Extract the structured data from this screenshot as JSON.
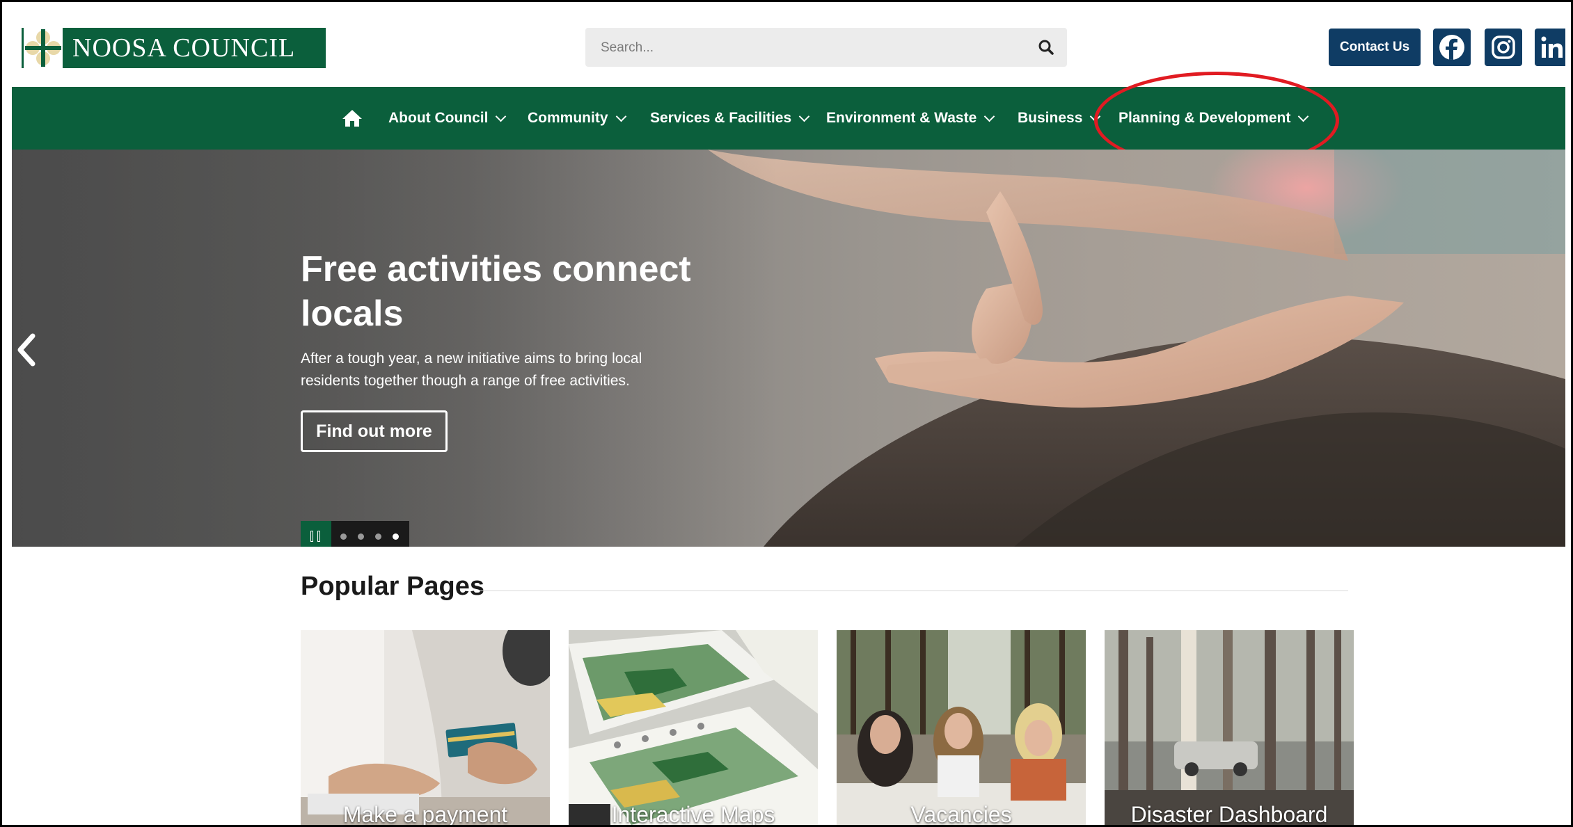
{
  "header": {
    "logo_text": "NOOSA COUNCIL",
    "search_placeholder": "Search...",
    "contact_label": "Contact Us",
    "social": [
      "facebook-icon",
      "instagram-icon",
      "linkedin-icon"
    ],
    "brand_color": "#0b5f3c",
    "contact_color": "#0f3c64"
  },
  "nav": {
    "items": [
      {
        "label": "About Council"
      },
      {
        "label": "Community"
      },
      {
        "label": "Services & Facilities"
      },
      {
        "label": "Environment & Waste"
      },
      {
        "label": "Business"
      },
      {
        "label": "Planning & Development"
      }
    ],
    "highlight_color": "#e11b22"
  },
  "hero": {
    "title": "Free activities connect locals",
    "text": "After a tough year, a new initiative aims to bring local residents together though a range of free activities.",
    "button_label": "Find out more",
    "slides_count": 4,
    "active_slide": 4
  },
  "popular": {
    "title": "Popular Pages",
    "cards": [
      {
        "label": "Make a payment"
      },
      {
        "label": "Interactive Maps"
      },
      {
        "label": "Vacancies"
      },
      {
        "label": "Disaster Dashboard"
      }
    ]
  }
}
